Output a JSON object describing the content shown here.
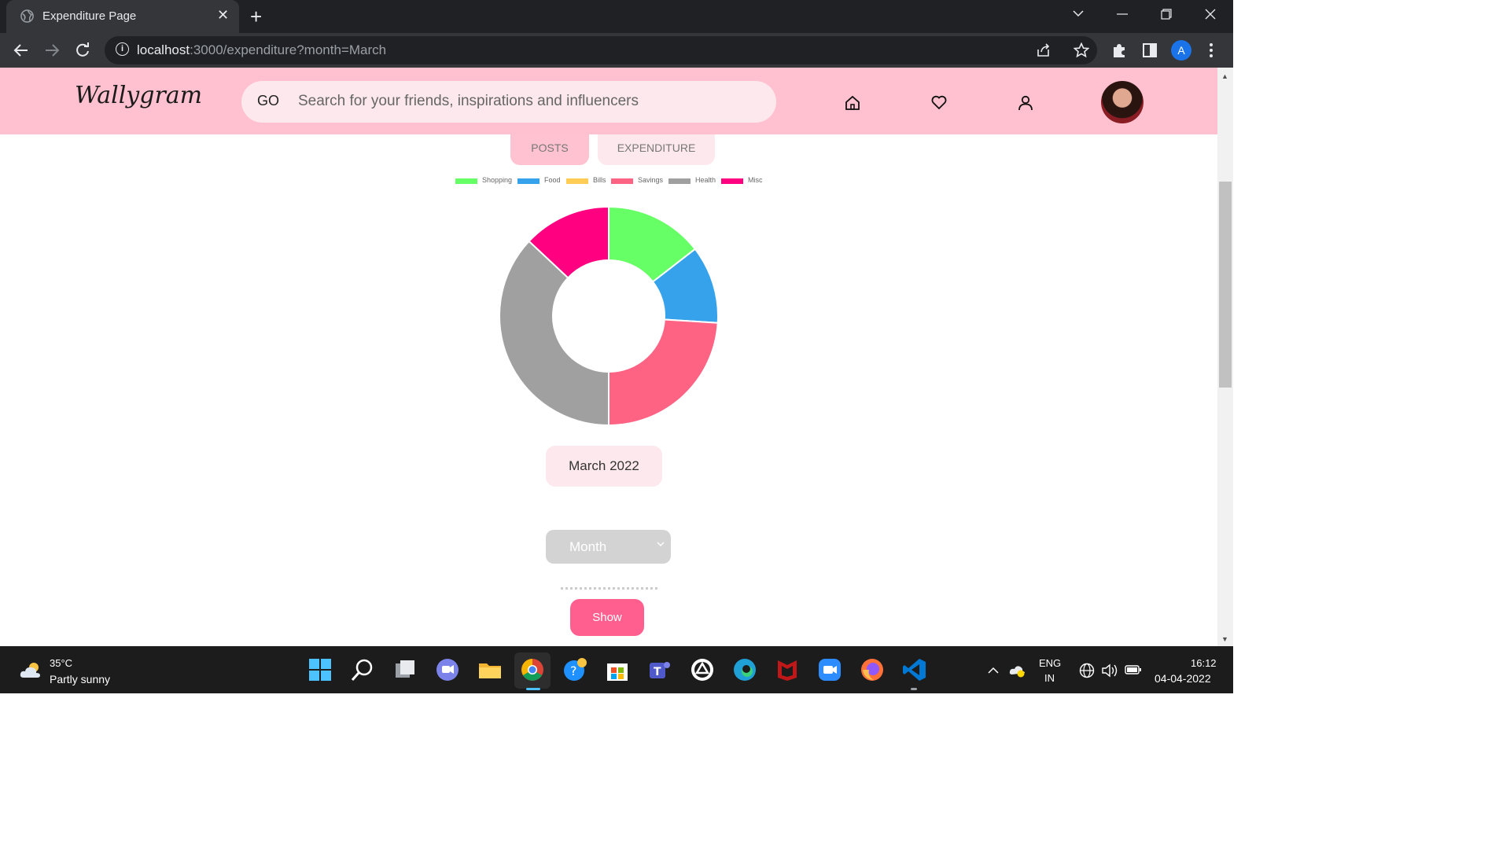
{
  "browser": {
    "tab_title": "Expenditure Page",
    "tab_close": "✕",
    "new_tab": "+",
    "url_host": "localhost",
    "url_rest": ":3000/expenditure?month=March",
    "profile_initial": "A"
  },
  "page": {
    "logo": "Wallygram",
    "search_go": "GO",
    "search_placeholder": "Search for your friends, inspirations and influencers",
    "tabs": {
      "posts": "POSTS",
      "expenditure": "EXPENDITURE"
    },
    "month_label": "March 2022",
    "month_select_value": "Month",
    "show_button": "Show"
  },
  "chart_data": {
    "type": "pie",
    "donut": true,
    "categories": [
      "Shopping",
      "Food",
      "Bills",
      "Savings",
      "Health",
      "Misc"
    ],
    "values": [
      14.5,
      11.5,
      0,
      24,
      37,
      13
    ],
    "colors": [
      "#66ff66",
      "#36a2eb",
      "#ffcd56",
      "#ff6384",
      "#a0a0a0",
      "#ff0080"
    ],
    "legend_position": "top"
  },
  "taskbar": {
    "weather_temp": "35°C",
    "weather_desc": "Partly sunny",
    "lang_top": "ENG",
    "lang_bottom": "IN",
    "time": "16:12",
    "date": "04-04-2022"
  }
}
